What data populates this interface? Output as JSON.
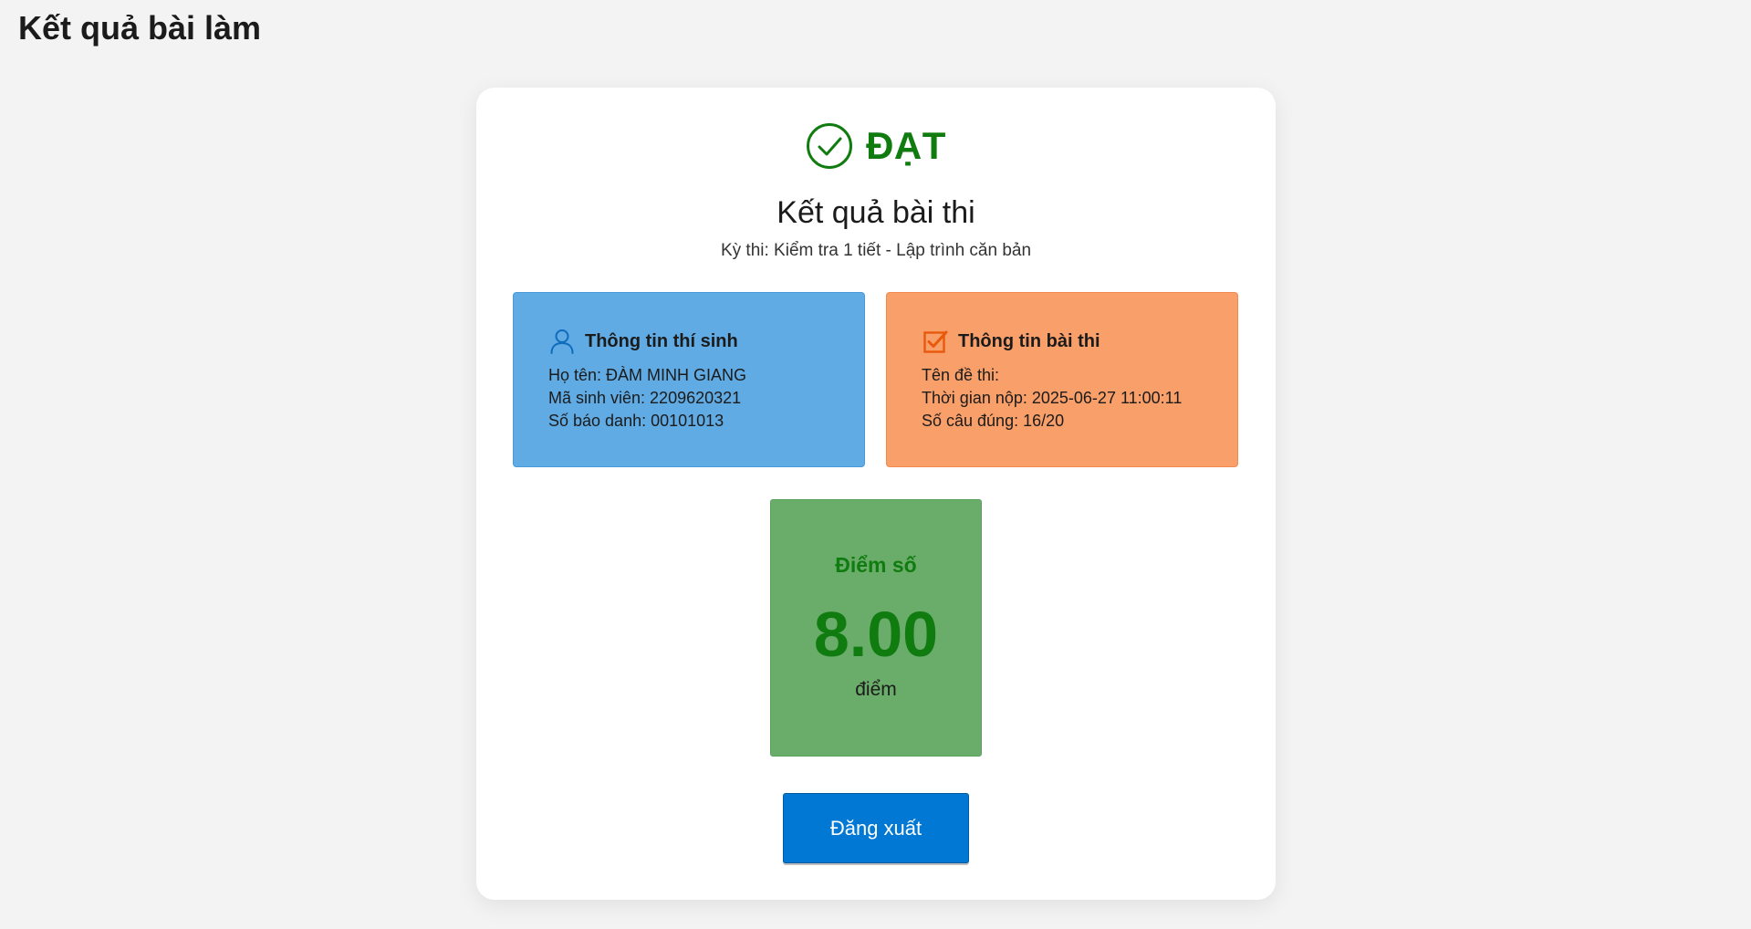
{
  "page": {
    "title": "Kết quả bài làm"
  },
  "result": {
    "status": "ĐẠT",
    "status_color": "#107c10",
    "heading": "Kết quả bài thi",
    "exam_line": "Kỳ thi: Kiểm tra 1 tiết - Lập trình căn bản"
  },
  "candidate": {
    "heading": "Thông tin thí sinh",
    "icon": "user-icon",
    "lines": [
      "Họ tên: ĐÀM MINH GIANG",
      "Mã sinh viên: 2209620321",
      "Số báo danh: 00101013"
    ],
    "color": "#61abe4"
  },
  "exam_info": {
    "heading": "Thông tin bài thi",
    "icon": "checkbox-icon",
    "lines": [
      "Tên đề thi:",
      "Thời gian nộp: 2025-06-27 11:00:11",
      "Số câu đúng: 16/20"
    ],
    "color": "#f99f69"
  },
  "score": {
    "label": "Điểm số",
    "value": "8.00",
    "unit": "điểm",
    "color": "#6aad6a"
  },
  "actions": {
    "logout_label": "Đăng xuất",
    "button_color": "#0078d4"
  }
}
